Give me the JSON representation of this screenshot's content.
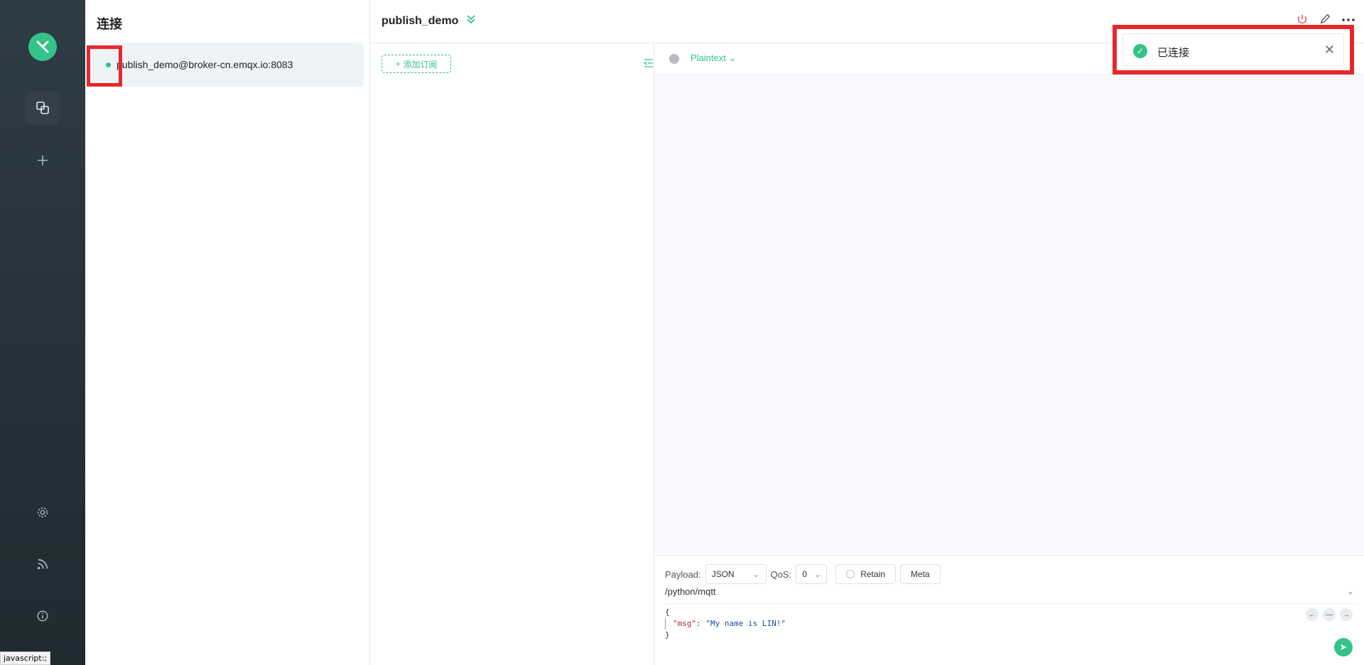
{
  "nav": {
    "logo": "✕",
    "items": [
      "connections-icon",
      "add-icon"
    ],
    "bottom": [
      "settings-icon",
      "rss-icon",
      "info-icon"
    ],
    "status_text": "javascript:;"
  },
  "connections": {
    "title": "连接",
    "items": [
      {
        "label": "publish_demo@broker-cn.emqx.io:8083",
        "status": "connected"
      }
    ]
  },
  "topbar": {
    "name": "publish_demo",
    "icons": [
      "power-icon",
      "edit-icon",
      "more-icon"
    ]
  },
  "subscriptions": {
    "add_label": "添加订阅"
  },
  "messages": {
    "filter_label": "Plaintext"
  },
  "publish": {
    "payload_label": "Payload:",
    "payload_format": "JSON",
    "qos_label": "QoS:",
    "qos_value": "0",
    "retain_label": "Retain",
    "meta_label": "Meta",
    "topic": "/python/mqtt",
    "code_lines": [
      "{",
      "\"msg\": \"My name is LIN!\"",
      "}"
    ],
    "code_key": "\"msg\"",
    "code_val": "\"My name is LIN!\""
  },
  "toast": {
    "text": "已连接"
  }
}
